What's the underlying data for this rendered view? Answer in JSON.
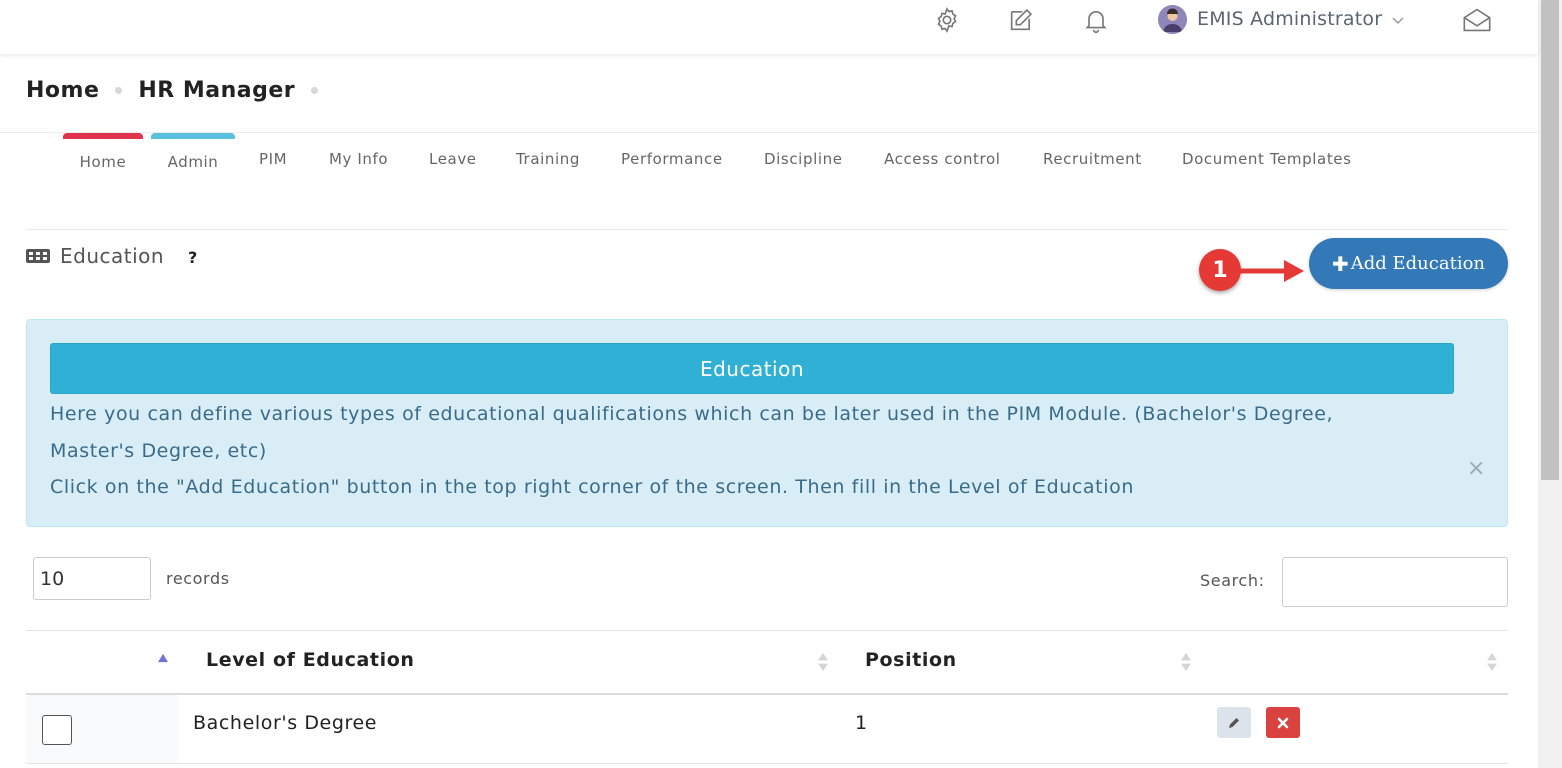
{
  "header": {
    "icons": [
      "gear-icon",
      "edit-icon",
      "bell-icon",
      "envelope-icon"
    ],
    "user_name": "EMIS Administrator"
  },
  "breadcrumb": [
    "Home",
    "HR Manager"
  ],
  "tabs": [
    {
      "label": "Home",
      "accent": "#e0344d"
    },
    {
      "label": "Admin",
      "accent": "#5bc0de"
    },
    {
      "label": "PIM"
    },
    {
      "label": "My Info"
    },
    {
      "label": "Leave"
    },
    {
      "label": "Training"
    },
    {
      "label": "Performance"
    },
    {
      "label": "Discipline"
    },
    {
      "label": "Access control"
    },
    {
      "label": "Recruitment"
    },
    {
      "label": "Document Templates"
    }
  ],
  "section": {
    "title": "Education",
    "help": "?"
  },
  "add_button": {
    "label": "Add Education",
    "color": "#3379b7"
  },
  "callout": {
    "number": "1"
  },
  "info": {
    "heading": "Education",
    "line1": "Here you can define various types of educational qualifications which can be later used in the PIM Module. (Bachelor's Degree,",
    "line2": "Master's Degree, etc)",
    "line3": "Click on the \"Add Education\" button in the top right corner of the screen. Then fill in the Level of Education",
    "close": "×"
  },
  "table_controls": {
    "page_length": "10",
    "records_label": "records",
    "search_label": "Search:",
    "search_value": ""
  },
  "table": {
    "columns": [
      "Level of Education",
      "Position"
    ],
    "rows": [
      {
        "level": "Bachelor's Degree",
        "position": "1"
      }
    ]
  }
}
